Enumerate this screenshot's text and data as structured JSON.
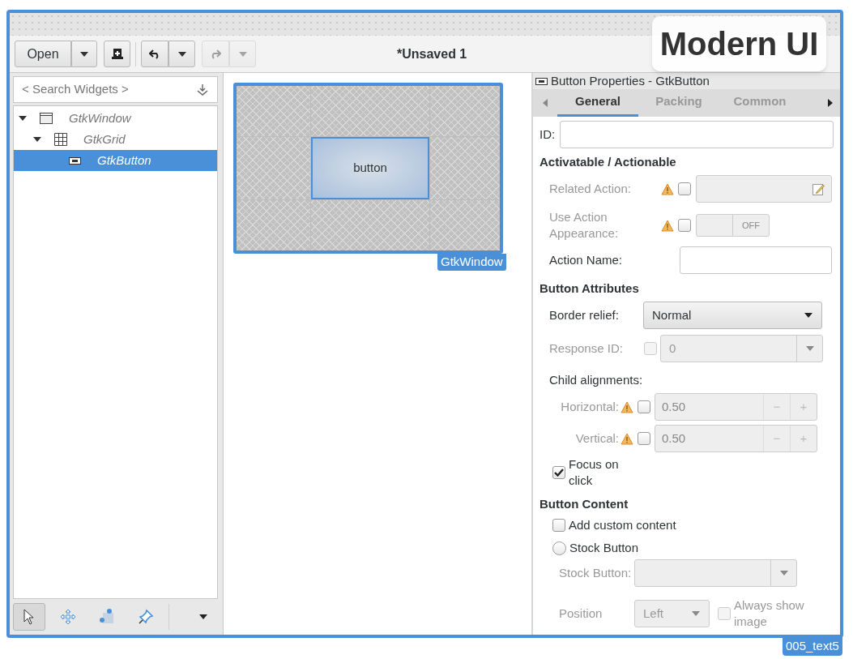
{
  "overlay_badge": "Modern UI",
  "frame_label": "005_text5",
  "header": {
    "title": "*Unsaved 1",
    "open_label": "Open",
    "redo_disabled": true
  },
  "widgets": {
    "search_placeholder": "< Search Widgets >",
    "tree": [
      {
        "label": "GtkWindow",
        "kind": "window",
        "expanded": true,
        "selected": false,
        "children": [
          {
            "label": "GtkGrid",
            "kind": "grid",
            "expanded": true,
            "selected": false,
            "children": [
              {
                "label": "GtkButton",
                "kind": "button",
                "selected": true
              }
            ]
          }
        ]
      }
    ],
    "tools": [
      {
        "kind": "pointer",
        "selected": true
      },
      {
        "kind": "move",
        "selected": false
      },
      {
        "kind": "resize",
        "selected": false
      },
      {
        "kind": "pin",
        "selected": false
      }
    ]
  },
  "canvas": {
    "window_label": "GtkWindow",
    "button_text": "button"
  },
  "properties": {
    "title": "Button Properties - GtkButton",
    "tabs": [
      {
        "label": "General",
        "selected": true
      },
      {
        "label": "Packing",
        "selected": false
      },
      {
        "label": "Common",
        "selected": false
      }
    ],
    "rows": [
      {
        "kind": "entry",
        "label": "ID:"
      },
      {
        "kind": "heading",
        "label": "Activatable / Actionable"
      },
      {
        "kind": "action",
        "label": "Related Action:",
        "disabled": true,
        "warning": true,
        "checked": false
      },
      {
        "kind": "switch",
        "label": "Use Action Appearance:",
        "disabled": true,
        "warning": true,
        "checked": false,
        "switch_on": false,
        "switch_text": "OFF"
      },
      {
        "kind": "entry_wide",
        "label": "Action Name:"
      },
      {
        "kind": "heading",
        "label": "Button Attributes"
      },
      {
        "kind": "combo",
        "label": "Border relief:",
        "value": "Normal",
        "disabled": false
      },
      {
        "kind": "check_combo",
        "label": "Response ID:",
        "value": "0",
        "disabled": true,
        "checked": false
      },
      {
        "kind": "subheading",
        "label": "Child alignments:"
      },
      {
        "kind": "spin",
        "label": "Horizontal:",
        "value": "0.50",
        "warning": true,
        "checked": false,
        "minus": "−",
        "plus": "+"
      },
      {
        "kind": "spin",
        "label": "Vertical:",
        "value": "0.50",
        "warning": true,
        "checked": false,
        "minus": "−",
        "plus": "+"
      },
      {
        "kind": "check",
        "label": "Focus on click",
        "checked": true
      },
      {
        "kind": "heading",
        "label": "Button Content"
      },
      {
        "kind": "check",
        "label": "Add custom content",
        "checked": false
      },
      {
        "kind": "radio",
        "label": "Stock Button",
        "selected": false
      },
      {
        "kind": "combo",
        "label": "Stock Button:",
        "value": "",
        "disabled": true
      },
      {
        "kind": "position",
        "label": "Position",
        "value": "Left",
        "check_label": "Always show image",
        "checked": false
      }
    ]
  }
}
